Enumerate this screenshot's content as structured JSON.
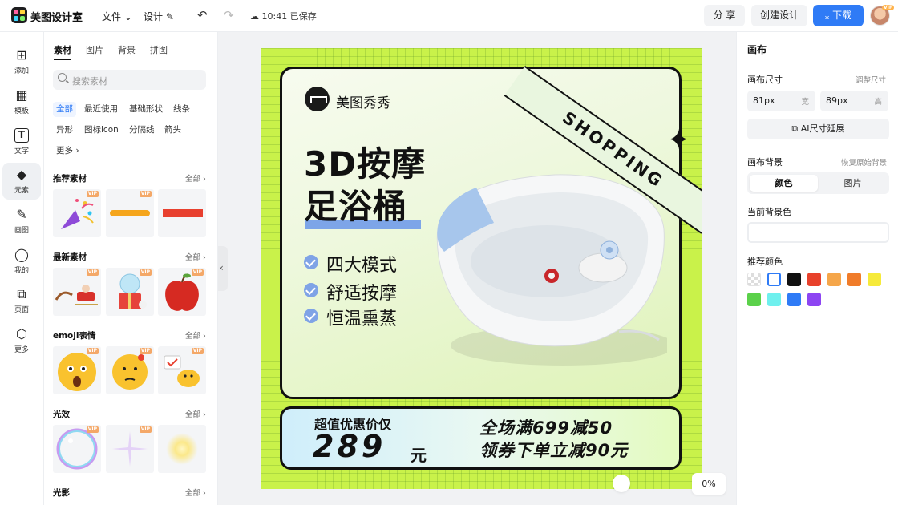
{
  "topbar": {
    "app_name": "美图设计室",
    "file_menu": "文件",
    "design_menu": "设计",
    "save_status": "10:41 已保存",
    "share": "分 享",
    "create": "创建设计",
    "download": "下载"
  },
  "rail": {
    "items": [
      {
        "label": "添加",
        "icon": "plus-square-icon"
      },
      {
        "label": "模板",
        "icon": "template-grid-icon"
      },
      {
        "label": "文字",
        "icon": "text-T-icon"
      },
      {
        "label": "元素",
        "icon": "element-shapes-icon"
      },
      {
        "label": "画图",
        "icon": "draw-pencil-icon"
      },
      {
        "label": "我的",
        "icon": "user-icon"
      },
      {
        "label": "页面",
        "icon": "add-page-icon"
      },
      {
        "label": "更多",
        "icon": "more-cube-icon"
      }
    ]
  },
  "panel": {
    "tabs": [
      "素材",
      "图片",
      "背景",
      "拼图"
    ],
    "search_placeholder": "搜索素材",
    "chips": [
      "全部",
      "最近使用",
      "基础形状",
      "线条",
      "异形",
      "图标icon",
      "分隔线",
      "箭头",
      "更多"
    ],
    "sections": [
      {
        "title": "推荐素材",
        "all": "全部"
      },
      {
        "title": "最新素材",
        "all": "全部"
      },
      {
        "title": "emoji表情",
        "all": "全部"
      },
      {
        "title": "光效",
        "all": "全部"
      },
      {
        "title": "光影",
        "all": "全部"
      }
    ],
    "vip_badge": "VIP"
  },
  "poster": {
    "brand": "美图秀秀",
    "ribbon": "SHOPPING",
    "headline_1": "3D按摩",
    "headline_2": "足浴桶",
    "features": [
      "四大模式",
      "舒适按摩",
      "恒温熏蒸"
    ],
    "price_label": "超值优惠价仅",
    "price_value": "289",
    "price_unit": "元",
    "promo_1": "全场满699减50",
    "promo_2": "领券下单立减90元"
  },
  "zoom": "0%",
  "rpanel": {
    "title": "画布",
    "size_label": "画布尺寸",
    "size_link": "调整尺寸",
    "width_value": "81px",
    "width_unit": "宽",
    "height_value": "89px",
    "height_unit": "高",
    "ai_button": "AI尺寸延展",
    "bg_label": "画布背景",
    "bg_link": "恢复原始背景",
    "seg": [
      "颜色",
      "图片"
    ],
    "current_color_label": "当前背景色",
    "recommended_label": "推荐颜色",
    "swatches": [
      "transparent",
      "#ffffff",
      "#111111",
      "#e8412b",
      "#f5a64a",
      "#f07c2a",
      "#f6ea3a",
      "#5bd14a",
      "#6ff0ee",
      "#2f7bf6",
      "#8d45f2"
    ]
  }
}
